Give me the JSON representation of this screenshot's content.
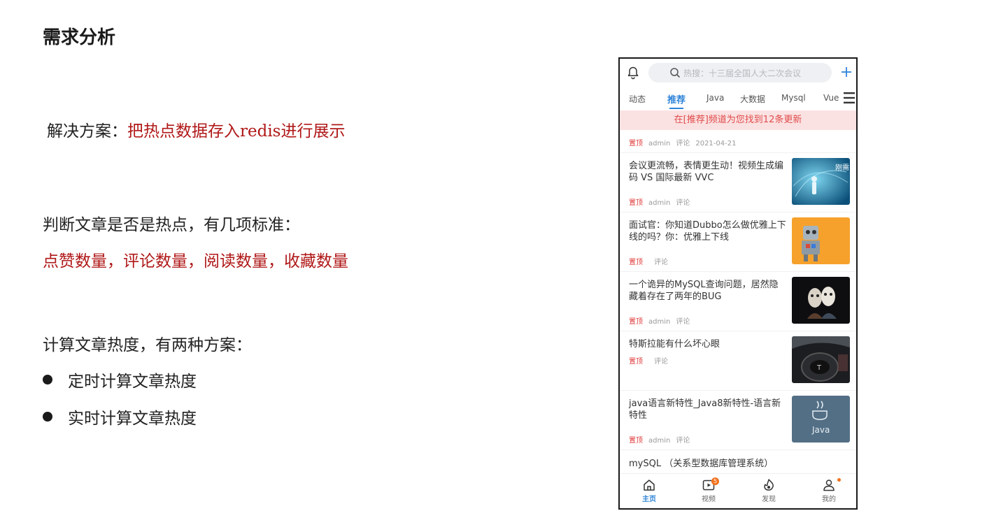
{
  "doc": {
    "title": "需求分析",
    "solution_prefix": "解决方案：",
    "solution_text": "把热点数据存入redis进行展示",
    "criteria_heading": "判断文章是否是热点，有几项标准：",
    "criteria_list": "点赞数量，评论数量，阅读数量，收藏数量",
    "calc_heading": "计算文章热度，有两种方案：",
    "bullets": [
      "定时计算文章热度",
      "实时计算文章热度"
    ]
  },
  "phone": {
    "search_placeholder": "热搜：十三届全国人大二次会议",
    "tabs": [
      "动态",
      "推荐",
      "Java",
      "大数据",
      "Mysql",
      "Vue"
    ],
    "active_tab_index": 1,
    "banner": "在[推荐]频道为您找到12条更新",
    "first_meta": {
      "tag": "置顶",
      "author": "admin",
      "comment": "评论",
      "date": "2021-04-21"
    },
    "articles": [
      {
        "title": "会议更流畅，表情更生动！视频生成编码 VS 国际最新 VVC",
        "tag": "置顶",
        "author": "admin",
        "comment": "评论",
        "thumb": "video-codec",
        "thumb_text": "刚需"
      },
      {
        "title": "面试官：你知道Dubbo怎么做优雅上下线的吗？你：优雅上下线",
        "tag": "置顶",
        "author": "",
        "comment": "评论",
        "thumb": "robot"
      },
      {
        "title": "一个诡异的MySQL查询问题，居然隐藏着存在了两年的BUG",
        "tag": "置顶",
        "author": "admin",
        "comment": "评论",
        "thumb": "masks"
      },
      {
        "title": "特斯拉能有什么坏心眼",
        "tag": "置顶",
        "author": "",
        "comment": "评论",
        "thumb": "tesla"
      },
      {
        "title": "java语言新特性_Java8新特性-语言新特性",
        "tag": "置顶",
        "author": "admin",
        "comment": "评论",
        "thumb": "java",
        "thumb_text": "Java"
      }
    ],
    "last_title": "mySQL （关系型数据库管理系统）",
    "nav": [
      {
        "label": "主页",
        "icon": "home-icon",
        "active": true
      },
      {
        "label": "视频",
        "icon": "video-icon",
        "badge": "5"
      },
      {
        "label": "发现",
        "icon": "discover-icon"
      },
      {
        "label": "我的",
        "icon": "user-icon",
        "dot": true
      }
    ],
    "colors": {
      "accent": "#2f84d8",
      "tag_red": "#e03a3a",
      "banner_bg": "#fbe2e2",
      "badge": "#f2711c"
    }
  }
}
